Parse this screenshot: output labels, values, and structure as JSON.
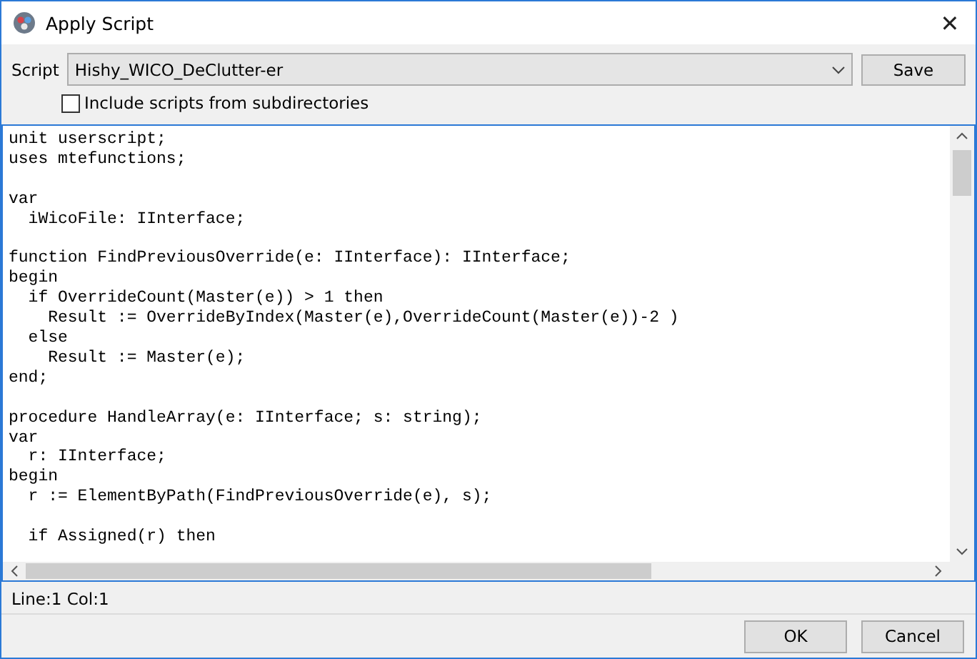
{
  "window": {
    "title": "Apply Script",
    "close": "✕"
  },
  "script_row": {
    "label": "Script",
    "value": "Hishy_WICO_DeClutter-er",
    "save": "Save"
  },
  "include_subdirs": {
    "label": "Include scripts from subdirectories",
    "checked": false
  },
  "editor": {
    "code": "unit userscript;\nuses mtefunctions;\n\nvar\n  iWicoFile: IInterface;\n\nfunction FindPreviousOverride(e: IInterface): IInterface;\nbegin\n  if OverrideCount(Master(e)) > 1 then\n    Result := OverrideByIndex(Master(e),OverrideCount(Master(e))-2 )\n  else\n    Result := Master(e);\nend;\n\nprocedure HandleArray(e: IInterface; s: string);\nvar\n  r: IInterface;\nbegin\n  r := ElementByPath(FindPreviousOverride(e), s);\n\n  if Assigned(r) then"
  },
  "status_bar": "Line:1 Col:1",
  "buttons": [
    "OK",
    "Cancel"
  ]
}
